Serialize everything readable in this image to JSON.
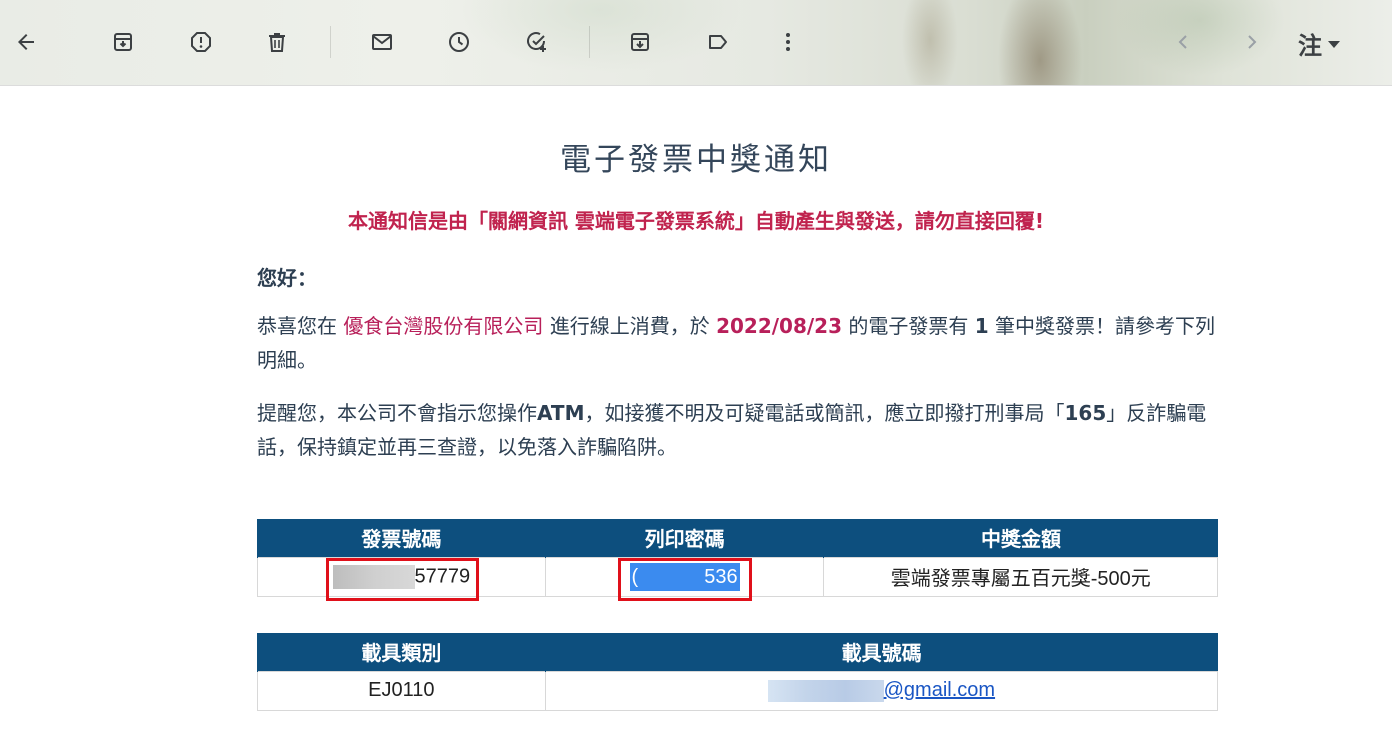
{
  "toolbar": {
    "icons": [
      "back-arrow-icon",
      "archive-icon",
      "report-spam-icon",
      "delete-icon",
      "mark-unread-icon",
      "snooze-icon",
      "add-task-icon",
      "move-to-icon",
      "label-icon",
      "more-options-icon",
      "prev-icon",
      "next-icon"
    ],
    "lang_label": "注"
  },
  "email": {
    "title": "電子發票中獎通知",
    "notice": "本通知信是由「關網資訊 雲端電子發票系統」自動產生與發送，請勿直接回覆!",
    "greeting": "您好：",
    "p1_before_company": "恭喜您在",
    "company": "優食台灣股份有限公司",
    "p1_mid": "進行線上消費，於",
    "date": "2022/08/23",
    "p1_after_date": "的電子發票有",
    "count": "1",
    "p1_tail": "筆中獎發票！請參考下列明細。",
    "p2_a": "提醒您，本公司不會指示您操作",
    "p2_atm": "ATM",
    "p2_b": "，如接獲不明及可疑電話或簡訊，應立即撥打刑事局",
    "p2_c": "「",
    "p2_165": "165",
    "p2_d": "」反詐騙電話，保持鎮定並再三查證，以免落入詐騙陷阱。"
  },
  "prize_table": {
    "headers": [
      "發票號碼",
      "列印密碼",
      "中獎金額"
    ],
    "invoice_suffix": "57779",
    "password_prefix": "(",
    "password_suffix": "536",
    "prize": "雲端發票專屬五百元獎-500元"
  },
  "carrier_table": {
    "headers": [
      "載具類別",
      "載具號碼"
    ],
    "carrier_type": "EJ0110",
    "carrier_email_domain": "@gmail.com"
  }
}
